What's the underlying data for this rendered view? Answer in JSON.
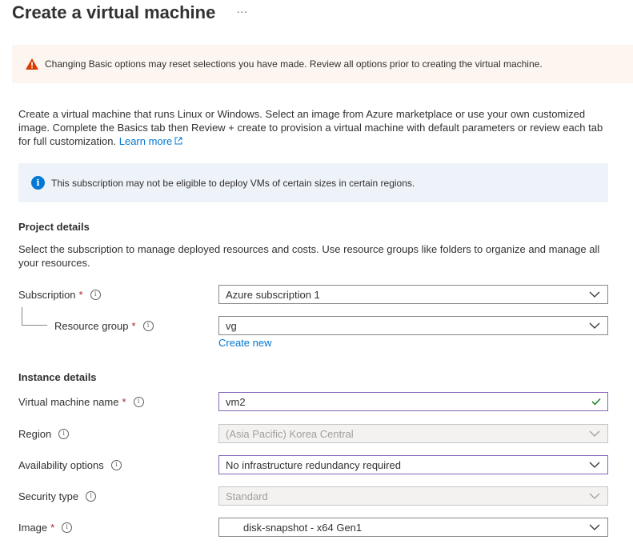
{
  "page": {
    "title": "Create a virtual machine",
    "more_label": "···"
  },
  "warning": {
    "text": "Changing Basic options may reset selections you have made. Review all options prior to creating the virtual machine."
  },
  "intro": {
    "text": "Create a virtual machine that runs Linux or Windows. Select an image from Azure marketplace or use your own customized image. Complete the Basics tab then Review + create to provision a virtual machine with default parameters or review each tab for full customization.",
    "learn_more": "Learn more"
  },
  "info": {
    "text": "This subscription may not be eligible to deploy VMs of certain sizes in certain regions."
  },
  "project_details": {
    "heading": "Project details",
    "description": "Select the subscription to manage deployed resources and costs. Use resource groups like folders to organize and manage all your resources.",
    "subscription": {
      "label": "Subscription",
      "required": "*",
      "value": "Azure subscription 1"
    },
    "resource_group": {
      "label": "Resource group",
      "required": "*",
      "value": "vg",
      "create_new": "Create new"
    }
  },
  "instance_details": {
    "heading": "Instance details",
    "vm_name": {
      "label": "Virtual machine name",
      "required": "*",
      "value": "vm2"
    },
    "region": {
      "label": "Region",
      "value": "(Asia Pacific) Korea Central"
    },
    "availability": {
      "label": "Availability options",
      "value": "No infrastructure redundancy required"
    },
    "security_type": {
      "label": "Security type",
      "value": "Standard"
    },
    "image": {
      "label": "Image",
      "required": "*",
      "value": "disk-snapshot - x64 Gen1"
    }
  },
  "info_icon_glyph": "i",
  "colors": {
    "accent": "#0078d4",
    "warning_bg": "#fdf6f0",
    "warning_icon": "#d83b01",
    "info_bg": "#eef3f9",
    "focus_border": "#8764b8",
    "required": "#a4262c",
    "valid_check": "#107c10"
  }
}
